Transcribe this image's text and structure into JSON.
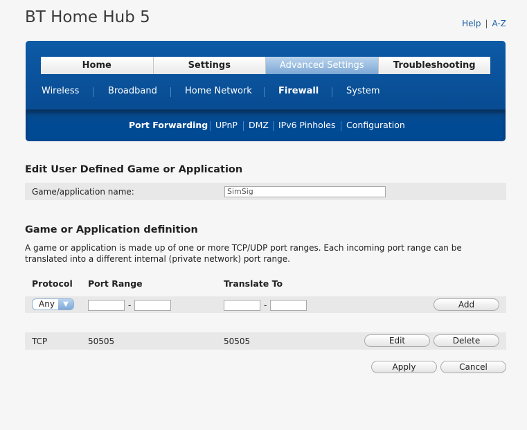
{
  "brand": "BT Home Hub 5",
  "toplinks": {
    "help": "Help",
    "sep": "|",
    "az": "A-Z"
  },
  "tabs": [
    "Home",
    "Settings",
    "Advanced Settings",
    "Troubleshooting"
  ],
  "active_tab": "Advanced Settings",
  "subnav": [
    "Wireless",
    "Broadband",
    "Home Network",
    "Firewall",
    "System"
  ],
  "active_subnav": "Firewall",
  "subsubnav": [
    "Port Forwarding",
    "UPnP",
    "DMZ",
    "IPv6 Pinholes",
    "Configuration"
  ],
  "active_subsubnav": "Port Forwarding",
  "edit_section": {
    "title": "Edit User Defined Game or Application",
    "name_label": "Game/application name:",
    "name_value": "SimSig"
  },
  "definition_section": {
    "title": "Game or Application definition",
    "description": "A game or application is made up of one or more TCP/UDP port ranges. Each incoming port range can be translated into a different internal (private network) port range.",
    "headers": {
      "protocol": "Protocol",
      "port_range": "Port Range",
      "translate_to": "Translate To"
    },
    "new_row": {
      "protocol_selected": "Any",
      "dash": "-",
      "add_label": "Add"
    },
    "rows": [
      {
        "protocol": "TCP",
        "port_range": "50505",
        "translate_to": "50505",
        "edit_label": "Edit",
        "delete_label": "Delete"
      }
    ]
  },
  "footer": {
    "apply_label": "Apply",
    "cancel_label": "Cancel"
  },
  "colors": {
    "nav_blue": "#0a4f96",
    "link_blue": "#1a5fa6",
    "active_tab": "#7ea8d4"
  }
}
